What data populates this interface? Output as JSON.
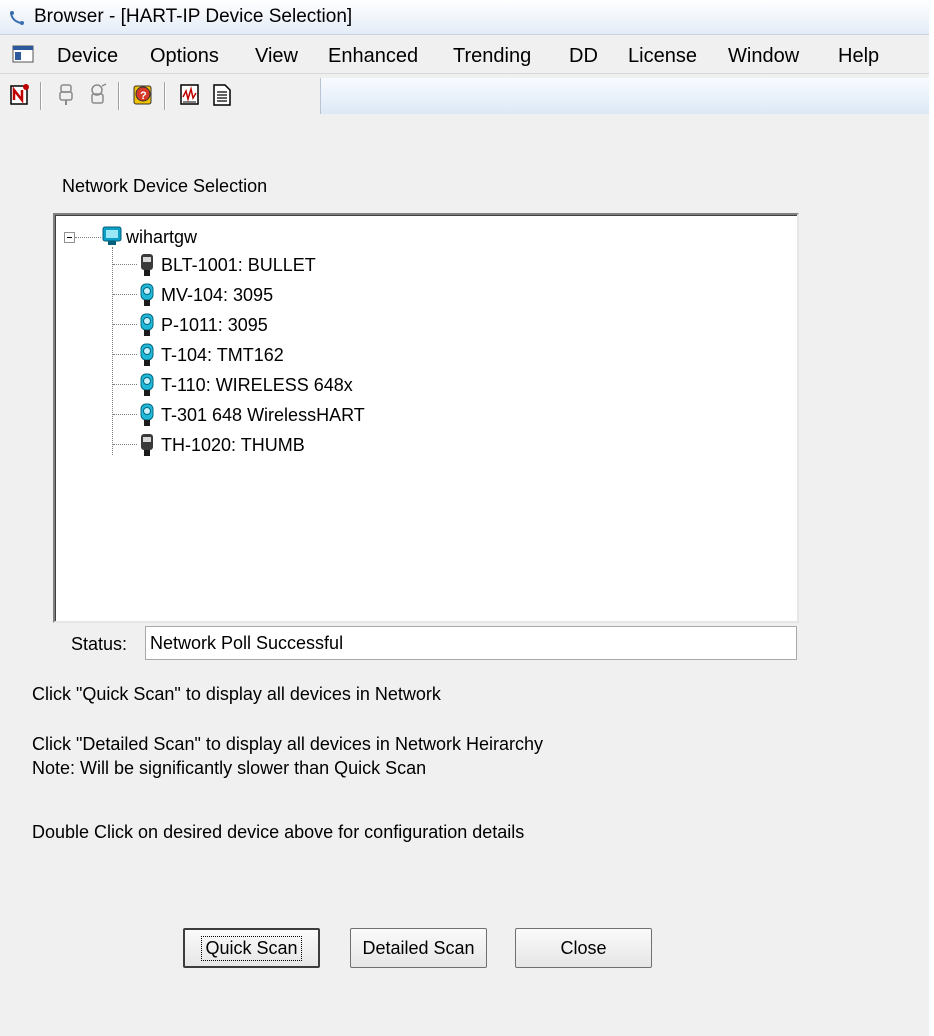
{
  "window": {
    "title": "Browser - [HART-IP Device Selection]",
    "accent": "#3c7fb1"
  },
  "menubar": {
    "items": [
      "Device",
      "Options",
      "View",
      "Enhanced",
      "Trending",
      "DD",
      "License",
      "Window",
      "Help"
    ]
  },
  "toolbar": {
    "buttons": [
      "new-connection-icon",
      "device-disabled-icon",
      "device-disabled-2-icon",
      "device-help-icon",
      "chart-icon",
      "report-icon"
    ]
  },
  "main": {
    "section_label": "Network Device Selection",
    "tree": {
      "root": "wihartgw",
      "children": [
        {
          "label": "BLT-1001: BULLET",
          "icon": "device-gray-icon"
        },
        {
          "label": "MV-104: 3095",
          "icon": "device-cyan-icon"
        },
        {
          "label": "P-1011: 3095",
          "icon": "device-cyan-icon"
        },
        {
          "label": "T-104: TMT162",
          "icon": "device-cyan-icon"
        },
        {
          "label": "T-110: WIRELESS 648x",
          "icon": "device-cyan-icon"
        },
        {
          "label": "T-301 648 WirelessHART",
          "icon": "device-cyan-icon"
        },
        {
          "label": "TH-1020: THUMB",
          "icon": "device-gray-icon"
        }
      ]
    },
    "status_label": "Status:",
    "status_value": "Network Poll Successful",
    "help_quick": "Click \"Quick Scan\" to display all devices in Network",
    "help_detailed": "Click \"Detailed Scan\" to display all devices in Network Heirarchy",
    "help_note": "Note: Will be significantly slower than Quick Scan",
    "help_double": "Double Click on desired device above for configuration details",
    "buttons": {
      "quick_scan": "Quick Scan",
      "detailed_scan": "Detailed Scan",
      "close": "Close"
    }
  }
}
